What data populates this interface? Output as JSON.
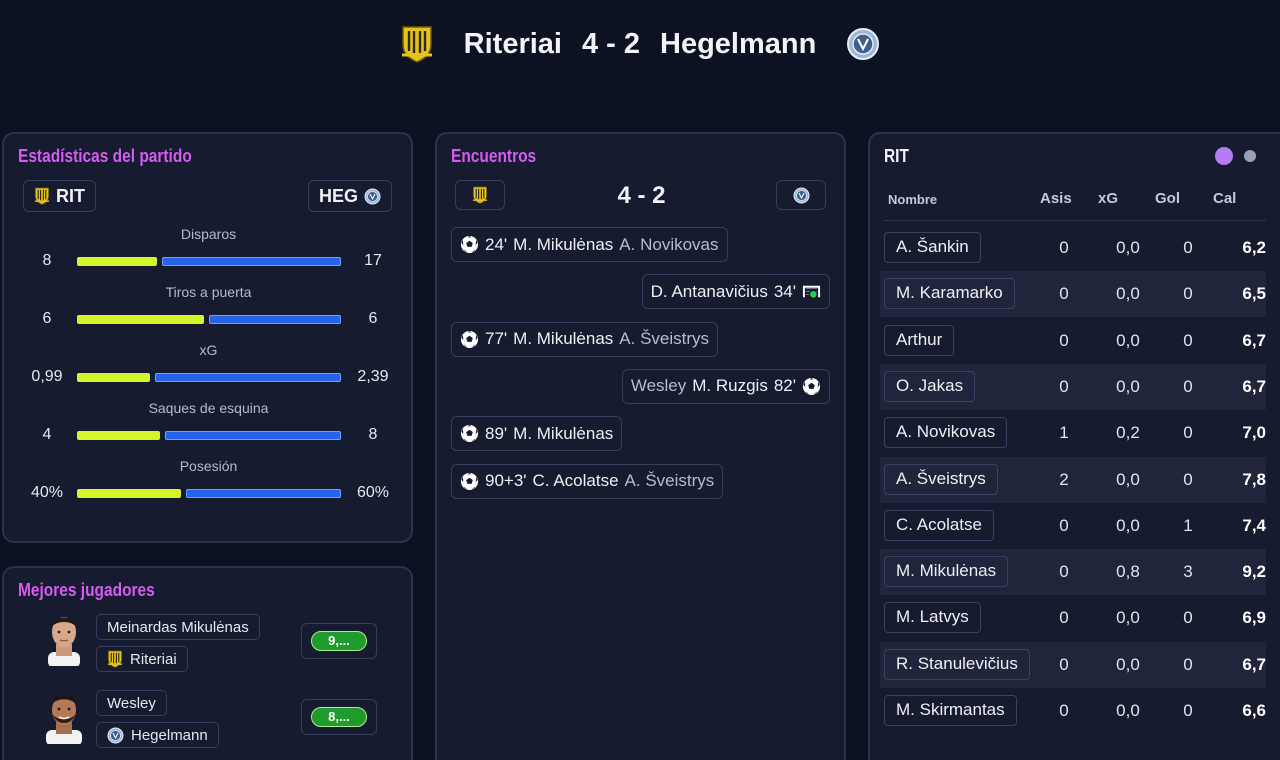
{
  "header": {
    "home_team": "Riteriai",
    "score": "4 - 2",
    "away_team": "Hegelmann"
  },
  "colors": {
    "home_bar": "#d4f52b",
    "away_bar": "#2563eb",
    "accent_title": "#d45cf0",
    "rating_green": "#1f9a2c"
  },
  "stats": {
    "title": "Estadísticas del partido",
    "home_abbr": "RIT",
    "away_abbr": "HEG",
    "rows": [
      {
        "label": "Disparos",
        "home": "8",
        "away": "17",
        "home_share": 0.31
      },
      {
        "label": "Tiros a puerta",
        "home": "6",
        "away": "6",
        "home_share": 0.49
      },
      {
        "label": "xG",
        "home": "0,99",
        "away": "2,39",
        "home_share": 0.28
      },
      {
        "label": "Saques de esquina",
        "home": "4",
        "away": "8",
        "home_share": 0.32
      },
      {
        "label": "Posesión",
        "home": "40%",
        "away": "60%",
        "home_share": 0.4
      }
    ]
  },
  "top_players": {
    "title": "Mejores jugadores",
    "players": [
      {
        "name": "Meinardas Mikulėnas",
        "team": "Riteriai",
        "rating": "9,..."
      },
      {
        "name": "Wesley",
        "team": "Hegelmann",
        "rating": "8,..."
      }
    ]
  },
  "events": {
    "title": "Encuentros",
    "score": "4 - 2",
    "items": [
      {
        "side": "home",
        "type": "goal-icon",
        "minute": "24'",
        "player": "M. Mikulėnas",
        "assist": "A. Novikovas"
      },
      {
        "side": "away",
        "type": "own-goal-icon",
        "minute": "34'",
        "player": "D. Antanavičius",
        "assist": ""
      },
      {
        "side": "home",
        "type": "goal-icon",
        "minute": "77'",
        "player": "M. Mikulėnas",
        "assist": "A. Šveistrys"
      },
      {
        "side": "away",
        "type": "goal-icon",
        "minute": "82'",
        "player": "M. Ruzgis",
        "assist": "Wesley"
      },
      {
        "side": "home",
        "type": "goal-icon",
        "minute": "89'",
        "player": "M. Mikulėnas",
        "assist": ""
      },
      {
        "side": "home",
        "type": "goal-icon",
        "minute": "90+3'",
        "player": "C. Acolatse",
        "assist": "A. Šveistrys"
      }
    ]
  },
  "lineup": {
    "title": "RIT",
    "headers": {
      "name": "Nombre",
      "asis": "Asis",
      "xg": "xG",
      "gol": "Gol",
      "cal": "Cal"
    },
    "rows": [
      {
        "name": "A. Šankin",
        "asis": "0",
        "xg": "0,0",
        "gol": "0",
        "cal": "6,2"
      },
      {
        "name": "M. Karamarko",
        "asis": "0",
        "xg": "0,0",
        "gol": "0",
        "cal": "6,5"
      },
      {
        "name": "Arthur",
        "asis": "0",
        "xg": "0,0",
        "gol": "0",
        "cal": "6,7"
      },
      {
        "name": "O. Jakas",
        "asis": "0",
        "xg": "0,0",
        "gol": "0",
        "cal": "6,7"
      },
      {
        "name": "A. Novikovas",
        "asis": "1",
        "xg": "0,2",
        "gol": "0",
        "cal": "7,0"
      },
      {
        "name": "A. Šveistrys",
        "asis": "2",
        "xg": "0,0",
        "gol": "0",
        "cal": "7,8"
      },
      {
        "name": "C. Acolatse",
        "asis": "0",
        "xg": "0,0",
        "gol": "1",
        "cal": "7,4"
      },
      {
        "name": "M. Mikulėnas",
        "asis": "0",
        "xg": "0,8",
        "gol": "3",
        "cal": "9,2"
      },
      {
        "name": "M. Latvys",
        "asis": "0",
        "xg": "0,0",
        "gol": "0",
        "cal": "6,9"
      },
      {
        "name": "R. Stanulevičius",
        "asis": "0",
        "xg": "0,0",
        "gol": "0",
        "cal": "6,7"
      },
      {
        "name": "M. Skirmantas",
        "asis": "0",
        "xg": "0,0",
        "gol": "0",
        "cal": "6,6"
      }
    ]
  }
}
